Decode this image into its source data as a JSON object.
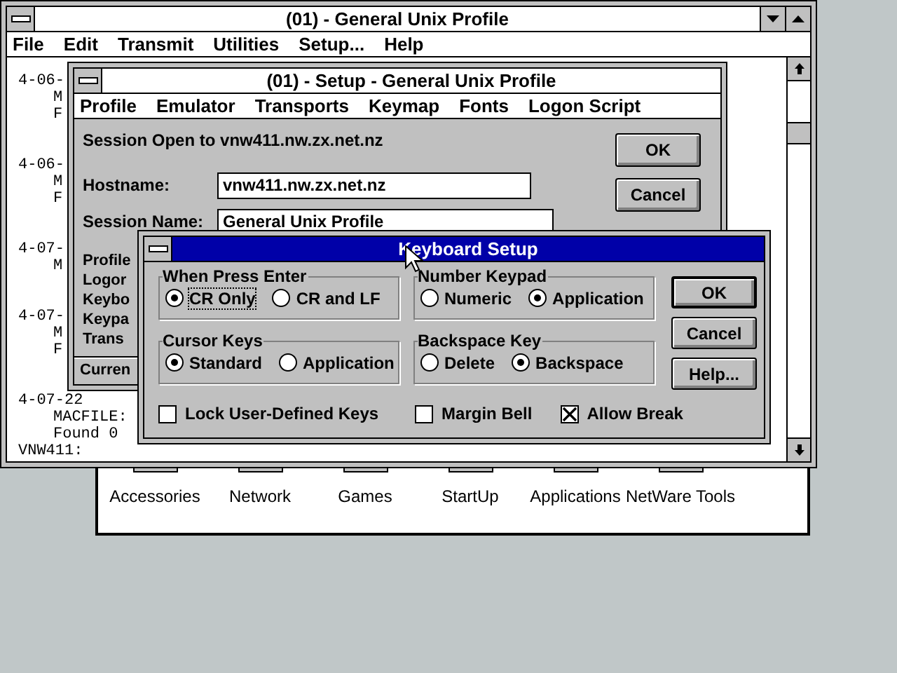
{
  "program_groups": [
    "Accessories",
    "Network",
    "Games",
    "StartUp",
    "Applications",
    "NetWare Tools"
  ],
  "terminal_window": {
    "title": "(01) - General Unix Profile",
    "menu": [
      "File",
      "Edit",
      "Transmit",
      "Utilities",
      "Setup...",
      "Help"
    ],
    "line_groups": [
      [
        {
          "text": "4-06-",
          "kind": "header"
        },
        {
          "text": "M",
          "kind": "detail"
        },
        {
          "text": "F",
          "kind": "detail"
        }
      ],
      [
        {
          "text": "4-06-",
          "kind": "header"
        },
        {
          "text": "M",
          "kind": "detail"
        },
        {
          "text": "F",
          "kind": "detail"
        }
      ],
      [
        {
          "text": "4-07-",
          "kind": "header"
        },
        {
          "text": "M",
          "kind": "detail"
        }
      ],
      [
        {
          "text": "4-07-",
          "kind": "header"
        },
        {
          "text": "M",
          "kind": "detail"
        },
        {
          "text": "F",
          "kind": "detail"
        }
      ],
      [
        {
          "text": "4-07-22",
          "kind": "header"
        },
        {
          "text": "MACFILE:",
          "kind": "detail"
        },
        {
          "text": "Found 0",
          "kind": "detail"
        },
        {
          "text": "VNW411:",
          "kind": "header"
        }
      ]
    ]
  },
  "setup_window": {
    "title": "(01) - Setup - General Unix Profile",
    "menu": [
      "Profile",
      "Emulator",
      "Transports",
      "Keymap",
      "Fonts",
      "Logon Script"
    ],
    "session_status": "Session Open to vnw411.nw.zx.net.nz",
    "fields": [
      {
        "label": "Hostname:",
        "value": "vnw411.nw.zx.net.nz"
      },
      {
        "label": "Session Name:",
        "value": "General Unix Profile"
      }
    ],
    "buttons": [
      "OK",
      "Cancel"
    ],
    "option_labels": [
      "Profile",
      "Logor",
      "Keybo",
      "Keypa",
      "Trans"
    ],
    "status_bar": "Curren"
  },
  "keyboard_dialog": {
    "title": "Keyboard Setup",
    "groups": [
      {
        "label": "When Press Enter",
        "options": [
          {
            "label": "CR Only",
            "selected": true,
            "focused": true
          },
          {
            "label": "CR and LF",
            "selected": false,
            "focused": false
          }
        ]
      },
      {
        "label": "Number Keypad",
        "options": [
          {
            "label": "Numeric",
            "selected": false,
            "focused": false
          },
          {
            "label": "Application",
            "selected": true,
            "focused": false
          }
        ]
      },
      {
        "label": "Cursor Keys",
        "options": [
          {
            "label": "Standard",
            "selected": true,
            "focused": false
          },
          {
            "label": "Application",
            "selected": false,
            "focused": false
          }
        ]
      },
      {
        "label": "Backspace Key",
        "options": [
          {
            "label": "Delete",
            "selected": false,
            "focused": false
          },
          {
            "label": "Backspace",
            "selected": true,
            "focused": false
          }
        ]
      }
    ],
    "checkboxes": [
      {
        "label": "Lock User-Defined Keys",
        "checked": false
      },
      {
        "label": "Margin Bell",
        "checked": false
      },
      {
        "label": "Allow Break",
        "checked": true
      }
    ],
    "buttons": [
      {
        "label": "OK",
        "default": true
      },
      {
        "label": "Cancel",
        "default": false
      },
      {
        "label": "Help...",
        "default": false
      }
    ]
  }
}
